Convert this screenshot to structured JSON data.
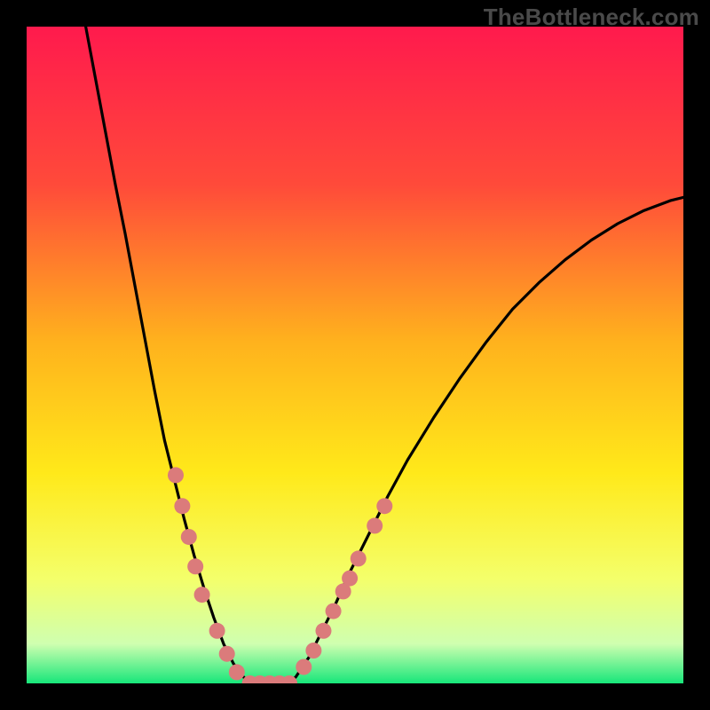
{
  "watermark": "TheBottleneck.com",
  "chart_data": {
    "type": "line",
    "title": "",
    "xlabel": "",
    "ylabel": "",
    "xlim": [
      0,
      100
    ],
    "ylim": [
      0,
      100
    ],
    "gradient_stops": [
      {
        "offset": 0,
        "color": "#ff1a4d"
      },
      {
        "offset": 24,
        "color": "#ff4a3a"
      },
      {
        "offset": 48,
        "color": "#ffb21d"
      },
      {
        "offset": 68,
        "color": "#ffe91a"
      },
      {
        "offset": 84,
        "color": "#f4ff6a"
      },
      {
        "offset": 94,
        "color": "#cfffb0"
      },
      {
        "offset": 100,
        "color": "#18e67a"
      }
    ],
    "series": [
      {
        "name": "left_arm",
        "type": "line",
        "points": [
          {
            "x": 9.0,
            "y": 100.0
          },
          {
            "x": 10.5,
            "y": 92.0
          },
          {
            "x": 12.0,
            "y": 84.0
          },
          {
            "x": 13.5,
            "y": 76.0
          },
          {
            "x": 15.0,
            "y": 68.5
          },
          {
            "x": 16.5,
            "y": 60.5
          },
          {
            "x": 18.0,
            "y": 52.5
          },
          {
            "x": 19.5,
            "y": 44.5
          },
          {
            "x": 21.0,
            "y": 37.0
          },
          {
            "x": 22.5,
            "y": 31.0
          },
          {
            "x": 24.0,
            "y": 25.0
          },
          {
            "x": 25.5,
            "y": 19.5
          },
          {
            "x": 27.0,
            "y": 14.5
          },
          {
            "x": 28.5,
            "y": 10.0
          },
          {
            "x": 30.0,
            "y": 6.0
          },
          {
            "x": 31.5,
            "y": 3.0
          },
          {
            "x": 33.0,
            "y": 1.0
          },
          {
            "x": 34.0,
            "y": 0.0
          }
        ]
      },
      {
        "name": "floor",
        "type": "line",
        "points": [
          {
            "x": 34.0,
            "y": 0.0
          },
          {
            "x": 40.0,
            "y": 0.0
          }
        ]
      },
      {
        "name": "right_arm",
        "type": "line",
        "points": [
          {
            "x": 40.0,
            "y": 0.0
          },
          {
            "x": 41.0,
            "y": 1.0
          },
          {
            "x": 43.0,
            "y": 4.0
          },
          {
            "x": 45.0,
            "y": 8.0
          },
          {
            "x": 47.0,
            "y": 12.0
          },
          {
            "x": 49.0,
            "y": 16.5
          },
          {
            "x": 52.0,
            "y": 22.5
          },
          {
            "x": 55.0,
            "y": 28.5
          },
          {
            "x": 58.0,
            "y": 34.0
          },
          {
            "x": 62.0,
            "y": 40.5
          },
          {
            "x": 66.0,
            "y": 46.5
          },
          {
            "x": 70.0,
            "y": 52.0
          },
          {
            "x": 74.0,
            "y": 57.0
          },
          {
            "x": 78.0,
            "y": 61.0
          },
          {
            "x": 82.0,
            "y": 64.5
          },
          {
            "x": 86.0,
            "y": 67.5
          },
          {
            "x": 90.0,
            "y": 70.0
          },
          {
            "x": 94.0,
            "y": 72.0
          },
          {
            "x": 98.0,
            "y": 73.5
          },
          {
            "x": 100.0,
            "y": 74.0
          }
        ]
      }
    ],
    "markers": [
      {
        "x": 22.7,
        "y": 31.7
      },
      {
        "x": 23.7,
        "y": 27.0
      },
      {
        "x": 24.7,
        "y": 22.3
      },
      {
        "x": 25.7,
        "y": 17.8
      },
      {
        "x": 26.7,
        "y": 13.5
      },
      {
        "x": 29.0,
        "y": 8.0
      },
      {
        "x": 30.5,
        "y": 4.5
      },
      {
        "x": 32.0,
        "y": 1.7
      },
      {
        "x": 34.0,
        "y": 0.0
      },
      {
        "x": 35.5,
        "y": 0.0
      },
      {
        "x": 37.0,
        "y": 0.0
      },
      {
        "x": 38.5,
        "y": 0.0
      },
      {
        "x": 40.0,
        "y": 0.0
      },
      {
        "x": 42.2,
        "y": 2.5
      },
      {
        "x": 43.7,
        "y": 5.0
      },
      {
        "x": 45.2,
        "y": 8.0
      },
      {
        "x": 46.7,
        "y": 11.0
      },
      {
        "x": 48.2,
        "y": 14.0
      },
      {
        "x": 49.2,
        "y": 16.0
      },
      {
        "x": 50.5,
        "y": 19.0
      },
      {
        "x": 53.0,
        "y": 24.0
      },
      {
        "x": 54.5,
        "y": 27.0
      }
    ],
    "marker_style": {
      "r": 9,
      "fill": "#db7b7b",
      "stroke": "none"
    }
  }
}
